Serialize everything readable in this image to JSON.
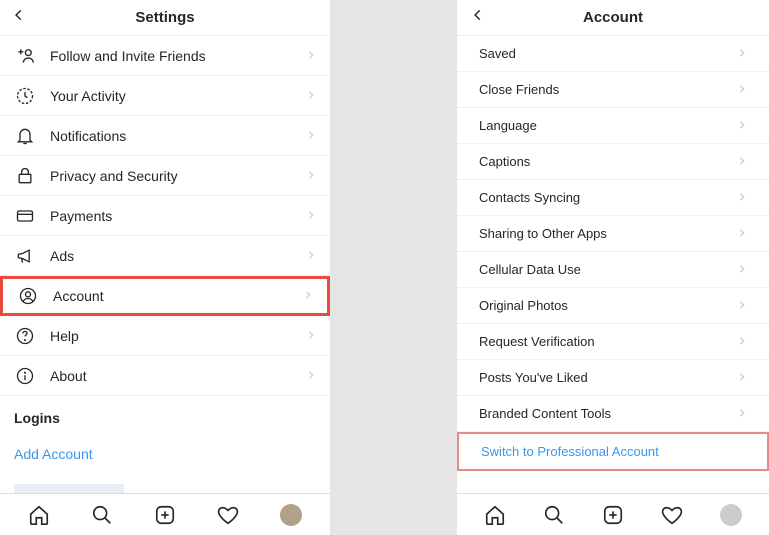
{
  "left": {
    "title": "Settings",
    "items": [
      {
        "label": "Follow and Invite Friends",
        "icon": "add-person"
      },
      {
        "label": "Your Activity",
        "icon": "activity"
      },
      {
        "label": "Notifications",
        "icon": "bell"
      },
      {
        "label": "Privacy and Security",
        "icon": "lock"
      },
      {
        "label": "Payments",
        "icon": "card"
      },
      {
        "label": "Ads",
        "icon": "megaphone"
      },
      {
        "label": "Account",
        "icon": "person-circle"
      },
      {
        "label": "Help",
        "icon": "help"
      },
      {
        "label": "About",
        "icon": "info"
      }
    ],
    "loginsHeader": "Logins",
    "addAccount": "Add Account"
  },
  "right": {
    "title": "Account",
    "items": [
      {
        "label": "Saved"
      },
      {
        "label": "Close Friends"
      },
      {
        "label": "Language"
      },
      {
        "label": "Captions"
      },
      {
        "label": "Contacts Syncing"
      },
      {
        "label": "Sharing to Other Apps"
      },
      {
        "label": "Cellular Data Use"
      },
      {
        "label": "Original Photos"
      },
      {
        "label": "Request Verification"
      },
      {
        "label": "Posts You've Liked"
      },
      {
        "label": "Branded Content Tools"
      }
    ],
    "switchLabel": "Switch to Professional Account"
  }
}
